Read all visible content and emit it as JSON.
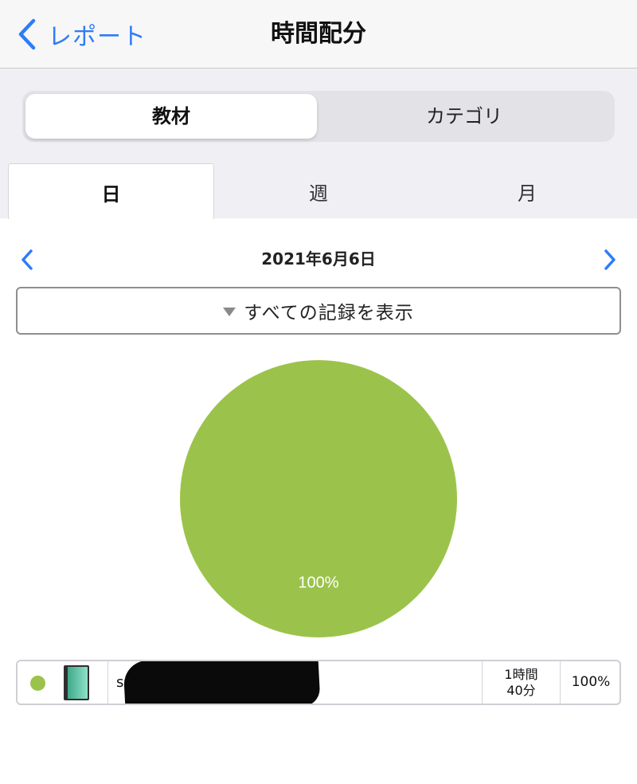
{
  "nav": {
    "back_label": "レポート",
    "title": "時間配分"
  },
  "segment": {
    "items": [
      {
        "label": "教材",
        "selected": true
      },
      {
        "label": "カテゴリ",
        "selected": false
      }
    ]
  },
  "period_tabs": [
    {
      "label": "日",
      "selected": true
    },
    {
      "label": "週",
      "selected": false
    },
    {
      "label": "月",
      "selected": false
    }
  ],
  "date": {
    "current": "2021年6月6日",
    "prev_icon": "chevron-left-icon",
    "next_icon": "chevron-right-icon"
  },
  "filter": {
    "label": "すべての記録を表示",
    "icon": "triangle-down-icon"
  },
  "colors": {
    "accent": "#2f7cf6",
    "slice": "#9bc34b"
  },
  "chart_data": {
    "type": "pie",
    "slices": [
      {
        "value": 100,
        "label": "100%",
        "color": "#9bc34b"
      }
    ]
  },
  "legend": [
    {
      "color": "#9bc34b",
      "icon": "book-icon",
      "name": "s",
      "name_redacted": true,
      "time_line1": "1時間",
      "time_line2": "40分",
      "percent": "100%"
    }
  ]
}
